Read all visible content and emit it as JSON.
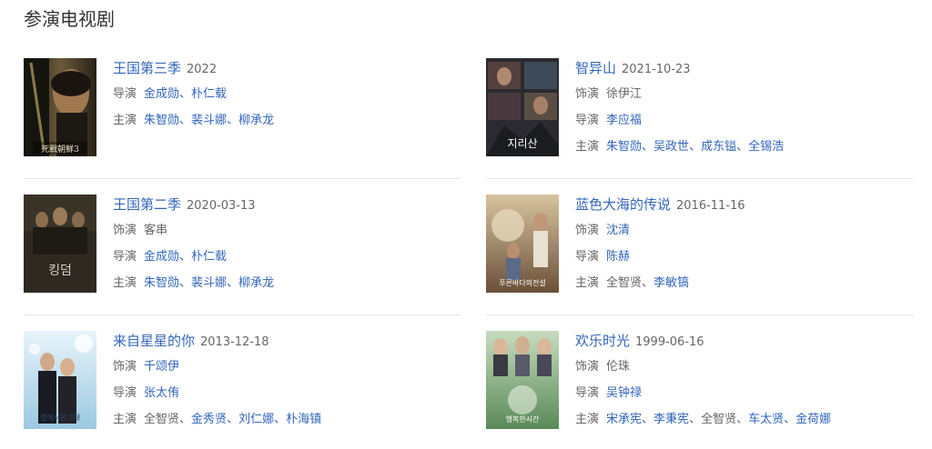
{
  "section": {
    "title": "参演电视剧"
  },
  "colors": {
    "link": "#3366bb",
    "muted": "#666666",
    "divider": "#e6e6e6"
  },
  "dramas": [
    {
      "title": "王国第三季",
      "date": "2022",
      "poster_caption": "死戰朝鮮3",
      "rows": [
        {
          "role": "导演",
          "people": [
            {
              "name": "金成勋",
              "link": true
            },
            {
              "name": "朴仁载",
              "link": true
            }
          ]
        },
        {
          "role": "主演",
          "people": [
            {
              "name": "朱智勋",
              "link": true
            },
            {
              "name": "裴斗娜",
              "link": true
            },
            {
              "name": "柳承龙",
              "link": true
            }
          ]
        }
      ]
    },
    {
      "title": "智异山",
      "date": "2021-10-23",
      "poster_caption": "지리산",
      "rows": [
        {
          "role": "饰演",
          "people": [
            {
              "name": "徐伊江",
              "link": false
            }
          ]
        },
        {
          "role": "导演",
          "people": [
            {
              "name": "李应福",
              "link": true
            }
          ]
        },
        {
          "role": "主演",
          "people": [
            {
              "name": "朱智勋",
              "link": true
            },
            {
              "name": "吴政世",
              "link": true
            },
            {
              "name": "成东镒",
              "link": true
            },
            {
              "name": "全锡浩",
              "link": true
            }
          ]
        }
      ]
    },
    {
      "title": "王国第二季",
      "date": "2020-03-13",
      "poster_caption": "킹덤",
      "rows": [
        {
          "role": "饰演",
          "people": [
            {
              "name": "客串",
              "link": false
            }
          ]
        },
        {
          "role": "导演",
          "people": [
            {
              "name": "金成勋",
              "link": true
            },
            {
              "name": "朴仁载",
              "link": true
            }
          ]
        },
        {
          "role": "主演",
          "people": [
            {
              "name": "朱智勋",
              "link": true
            },
            {
              "name": "裴斗娜",
              "link": true
            },
            {
              "name": "柳承龙",
              "link": true
            }
          ]
        }
      ]
    },
    {
      "title": "蓝色大海的传说",
      "date": "2016-11-16",
      "poster_caption": "푸른바다의전설",
      "rows": [
        {
          "role": "饰演",
          "people": [
            {
              "name": "沈清",
              "link": true
            }
          ]
        },
        {
          "role": "导演",
          "people": [
            {
              "name": "陈赫",
              "link": true
            }
          ]
        },
        {
          "role": "主演",
          "people": [
            {
              "name": "全智贤",
              "link": false
            },
            {
              "name": "李敏镐",
              "link": true
            }
          ]
        }
      ]
    },
    {
      "title": "来自星星的你",
      "date": "2013-12-18",
      "poster_caption": "별에서온그대",
      "rows": [
        {
          "role": "饰演",
          "people": [
            {
              "name": "千颂伊",
              "link": true
            }
          ]
        },
        {
          "role": "导演",
          "people": [
            {
              "name": "张太侑",
              "link": true
            }
          ]
        },
        {
          "role": "主演",
          "people": [
            {
              "name": "全智贤",
              "link": false
            },
            {
              "name": "金秀贤",
              "link": true
            },
            {
              "name": "刘仁娜",
              "link": true
            },
            {
              "name": "朴海镇",
              "link": true
            }
          ]
        }
      ]
    },
    {
      "title": "欢乐时光",
      "date": "1999-06-16",
      "poster_caption": "행복한시간",
      "rows": [
        {
          "role": "饰演",
          "people": [
            {
              "name": "伦珠",
              "link": false
            }
          ]
        },
        {
          "role": "导演",
          "people": [
            {
              "name": "吴钟禄",
              "link": true
            }
          ]
        },
        {
          "role": "主演",
          "people": [
            {
              "name": "宋承宪",
              "link": true
            },
            {
              "name": "李秉宪",
              "link": true
            },
            {
              "name": "全智贤",
              "link": false
            },
            {
              "name": "车太贤",
              "link": true
            },
            {
              "name": "金荷娜",
              "link": true
            }
          ]
        }
      ]
    }
  ]
}
